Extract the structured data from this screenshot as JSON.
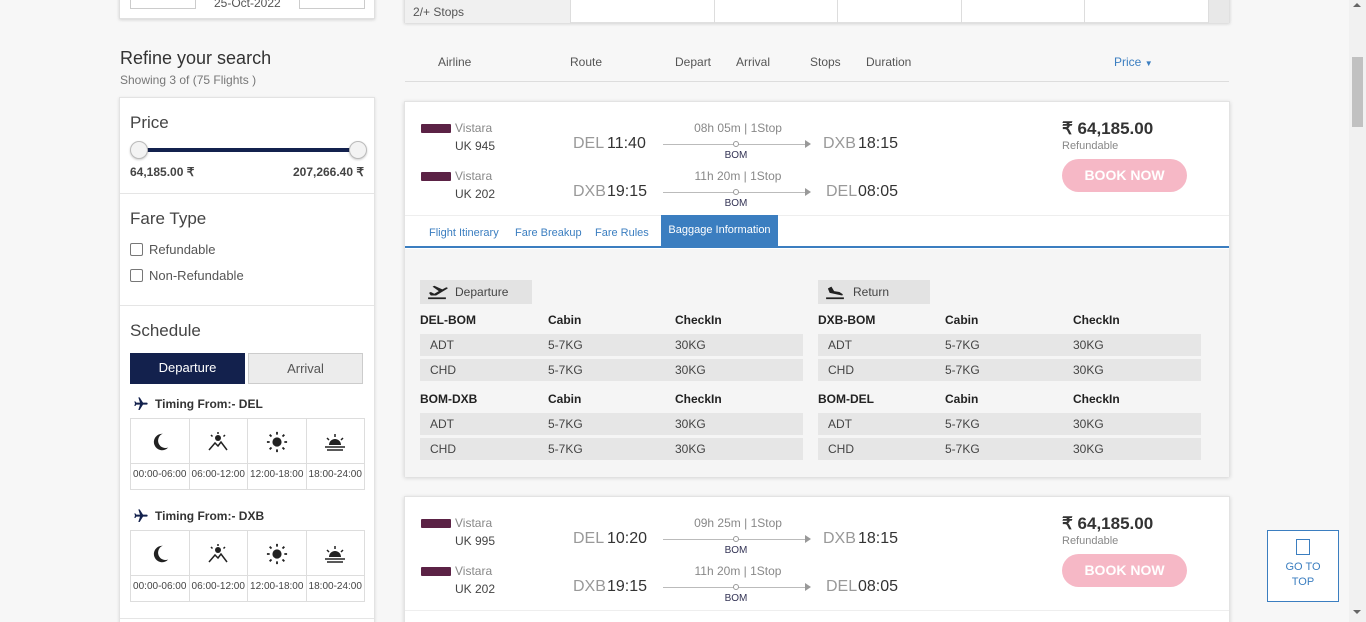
{
  "top": {
    "date": "25-Oct-2022",
    "stops_label": "2/+ Stops"
  },
  "refine": {
    "title": "Refine your search",
    "subtitle": "Showing 3 of (75 Flights )"
  },
  "filters": {
    "price_title": "Price",
    "price_min": "64,185.00 ₹",
    "price_max": "207,266.40 ₹",
    "fare_type_title": "Fare Type",
    "fare_options": [
      "Refundable",
      "Non-Refundable"
    ],
    "schedule_title": "Schedule",
    "departure_tab": "Departure",
    "arrival_tab": "Arrival",
    "timing_del": "Timing From:- DEL",
    "timing_dxb": "Timing From:- DXB",
    "slots": [
      "00:00-06:00",
      "06:00-12:00",
      "12:00-18:00",
      "18:00-24:00"
    ]
  },
  "columns": {
    "airline": "Airline",
    "route": "Route",
    "depart": "Depart",
    "arrival": "Arrival",
    "stops": "Stops",
    "duration": "Duration",
    "price": "Price"
  },
  "results": [
    {
      "price": "₹ 64,185.00",
      "refundable": "Refundable",
      "book": "BOOK NOW",
      "legs": [
        {
          "airline": "Vistara",
          "flight": "UK  945",
          "from": "DEL",
          "dep": "11:40",
          "duration": "08h 05m | 1Stop",
          "via": "BOM",
          "to": "DXB",
          "arr": "18:15"
        },
        {
          "airline": "Vistara",
          "flight": "UK  202",
          "from": "DXB",
          "dep": "19:15",
          "duration": "11h 20m | 1Stop",
          "via": "BOM",
          "to": "DEL",
          "arr": "08:05"
        }
      ],
      "tabs": [
        "Flight Itinerary",
        "Fare Breakup",
        "Fare Rules",
        "Baggage Information"
      ],
      "baggage": {
        "departure_label": "Departure",
        "return_label": "Return",
        "cabin": "Cabin",
        "checkin": "CheckIn",
        "dep_segments": [
          {
            "route": "DEL-BOM",
            "rows": [
              [
                "ADT",
                "5-7KG",
                "30KG"
              ],
              [
                "CHD",
                "5-7KG",
                "30KG"
              ]
            ]
          },
          {
            "route": "BOM-DXB",
            "rows": [
              [
                "ADT",
                "5-7KG",
                "30KG"
              ],
              [
                "CHD",
                "5-7KG",
                "30KG"
              ]
            ]
          }
        ],
        "ret_segments": [
          {
            "route": "DXB-BOM",
            "rows": [
              [
                "ADT",
                "5-7KG",
                "30KG"
              ],
              [
                "CHD",
                "5-7KG",
                "30KG"
              ]
            ]
          },
          {
            "route": "BOM-DEL",
            "rows": [
              [
                "ADT",
                "5-7KG",
                "30KG"
              ],
              [
                "CHD",
                "5-7KG",
                "30KG"
              ]
            ]
          }
        ]
      }
    },
    {
      "price": "₹ 64,185.00",
      "refundable": "Refundable",
      "book": "BOOK NOW",
      "legs": [
        {
          "airline": "Vistara",
          "flight": "UK  995",
          "from": "DEL",
          "dep": "10:20",
          "duration": "09h 25m | 1Stop",
          "via": "BOM",
          "to": "DXB",
          "arr": "18:15"
        },
        {
          "airline": "Vistara",
          "flight": "UK  202",
          "from": "DXB",
          "dep": "19:15",
          "duration": "11h 20m | 1Stop",
          "via": "BOM",
          "to": "DEL",
          "arr": "08:05"
        }
      ]
    }
  ],
  "goto_top": "GO TO TOP",
  "colors": {
    "navy": "#13214d",
    "accent": "#3b7ec0",
    "book": "#f6b8c6",
    "airline_logo": "#5b2245"
  }
}
